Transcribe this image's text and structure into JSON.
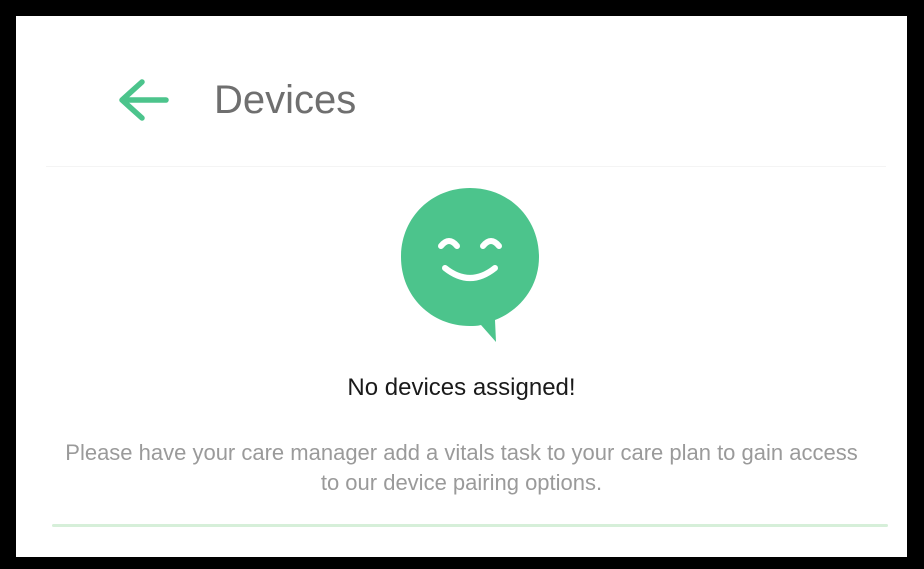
{
  "header": {
    "title": "Devices",
    "back_icon": "arrow-left-icon"
  },
  "empty_state": {
    "icon": "smiley-speech-bubble-icon",
    "title": "No devices assigned!",
    "message": "Please have your care manager add a vitals task to your care plan to gain access to our device pairing options."
  },
  "colors": {
    "accent": "#4cc48c",
    "title_text": "#6f6f6f",
    "heading_text": "#1a1a1a",
    "body_text": "#9a9a9a",
    "frame": "#000000",
    "background": "#ffffff"
  }
}
